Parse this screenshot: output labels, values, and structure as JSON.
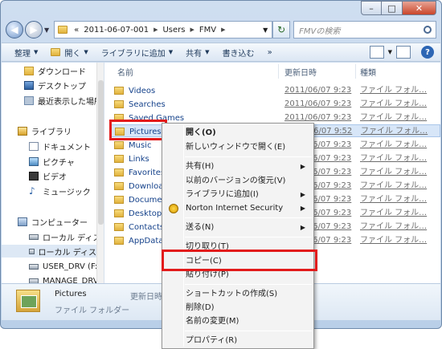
{
  "window": {
    "caption_buttons": {
      "minimize": "–",
      "maximize": "□",
      "close": "✕"
    }
  },
  "navigation": {
    "back_icon": "back-arrow-icon",
    "forward_icon": "forward-arrow-icon",
    "breadcrumb_prefix": "«",
    "breadcrumbs": [
      "2011-06-07-001",
      "Users",
      "FMV"
    ],
    "refresh_icon": "refresh-icon",
    "search_placeholder": "FMVの検索"
  },
  "toolbar": {
    "items": [
      {
        "label": "整理",
        "dropdown": true
      },
      {
        "label": "開く",
        "dropdown": true
      },
      {
        "label": "ライブラリに追加",
        "dropdown": true
      },
      {
        "label": "共有",
        "dropdown": true
      },
      {
        "label": "書き込む",
        "dropdown": false
      },
      {
        "label": "»",
        "dropdown": false
      }
    ],
    "help_label": "?"
  },
  "sidebar": {
    "items": [
      {
        "label": "ダウンロード",
        "icon": "folder-icon"
      },
      {
        "label": "デスクトップ",
        "icon": "desktop-icon"
      },
      {
        "label": "最近表示した場所",
        "icon": "recent-places-icon"
      },
      {
        "label": "ライブラリ",
        "icon": "library-icon"
      },
      {
        "label": "ドキュメント",
        "icon": "documents-icon"
      },
      {
        "label": "ピクチャ",
        "icon": "pictures-icon"
      },
      {
        "label": "ビデオ",
        "icon": "videos-icon"
      },
      {
        "label": "ミュージック",
        "icon": "music-icon"
      },
      {
        "label": "コンピューター",
        "icon": "computer-icon"
      },
      {
        "label": "ローカル ディス",
        "icon": "drive-icon"
      },
      {
        "label": "ローカル ディス",
        "icon": "drive-icon"
      },
      {
        "label": "USER_DRV (F:)",
        "icon": "drive-icon"
      },
      {
        "label": "MANAGE_DRV (",
        "icon": "drive-icon"
      }
    ]
  },
  "file_list": {
    "headers": {
      "name": "名前",
      "date": "更新日時",
      "type": "種類"
    },
    "rows": [
      {
        "name": "Videos",
        "date": "2011/06/07 9:23",
        "type": "ファイル フォル…"
      },
      {
        "name": "Searches",
        "date": "2011/06/07 9:23",
        "type": "ファイル フォル…"
      },
      {
        "name": "Saved Games",
        "date": "2011/06/07 9:23",
        "type": "ファイル フォル…"
      },
      {
        "name": "Pictures",
        "date": "2011/06/07 9:52",
        "type": "ファイル フォル…"
      },
      {
        "name": "Music",
        "date": "2011/06/07 9:23",
        "type": "ファイル フォル…"
      },
      {
        "name": "Links",
        "date": "2011/06/07 9:23",
        "type": "ファイル フォル…"
      },
      {
        "name": "Favorites",
        "date": "2011/06/07 9:23",
        "type": "ファイル フォル…"
      },
      {
        "name": "Downloads",
        "date": "2011/06/07 9:23",
        "type": "ファイル フォル…"
      },
      {
        "name": "Documents",
        "date": "2011/06/07 9:23",
        "type": "ファイル フォル…"
      },
      {
        "name": "Desktop",
        "date": "2011/06/07 9:23",
        "type": "ファイル フォル…"
      },
      {
        "name": "Contacts",
        "date": "2011/06/07 9:23",
        "type": "ファイル フォル…"
      },
      {
        "name": "AppData",
        "date": "2011/06/07 9:23",
        "type": "ファイル フォル…"
      }
    ]
  },
  "details_pane": {
    "name": "Pictures",
    "type": "ファイル フォルダー",
    "date_label": "更新日時:"
  },
  "context_menu": {
    "items": [
      {
        "label": "開く(O)",
        "bold": true
      },
      {
        "label": "新しいウィンドウで開く(E)"
      },
      {
        "label": "共有(H)",
        "submenu": true
      },
      {
        "label": "以前のバージョンの復元(V)"
      },
      {
        "label": "ライブラリに追加(I)",
        "submenu": true
      },
      {
        "label": "Norton Internet Security",
        "submenu": true,
        "icon": "norton-icon"
      },
      {
        "label": "送る(N)",
        "submenu": true
      },
      {
        "label": "切り取り(T)"
      },
      {
        "label": "コピー(C)"
      },
      {
        "label": "貼り付け(P)"
      },
      {
        "label": "ショートカットの作成(S)"
      },
      {
        "label": "削除(D)"
      },
      {
        "label": "名前の変更(M)"
      },
      {
        "label": "プロパティ(R)"
      }
    ],
    "submenu_arrow": "▶"
  },
  "highlight_color": "#e21b1b"
}
